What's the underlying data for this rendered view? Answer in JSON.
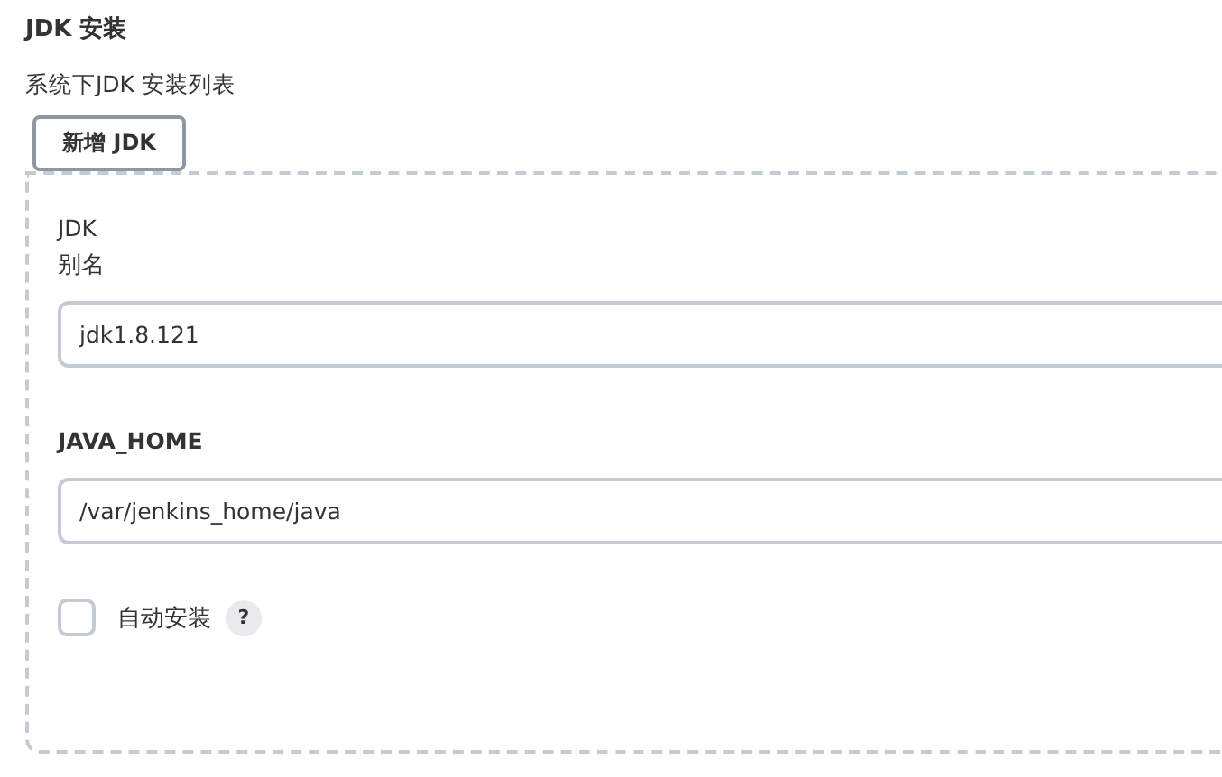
{
  "section": {
    "title": "JDK 安装",
    "description": "系统下JDK 安装列表"
  },
  "add_button": "新增 JDK",
  "jdk_panel": {
    "heading": "JDK",
    "fields": [
      {
        "label": "别名",
        "kind": "plain",
        "value": "jdk1.8.121"
      },
      {
        "label": "JAVA_HOME",
        "kind": "strong",
        "value": "/var/jenkins_home/java"
      }
    ],
    "auto_install": {
      "label": "自动安装",
      "checked": false,
      "help": "?"
    }
  }
}
